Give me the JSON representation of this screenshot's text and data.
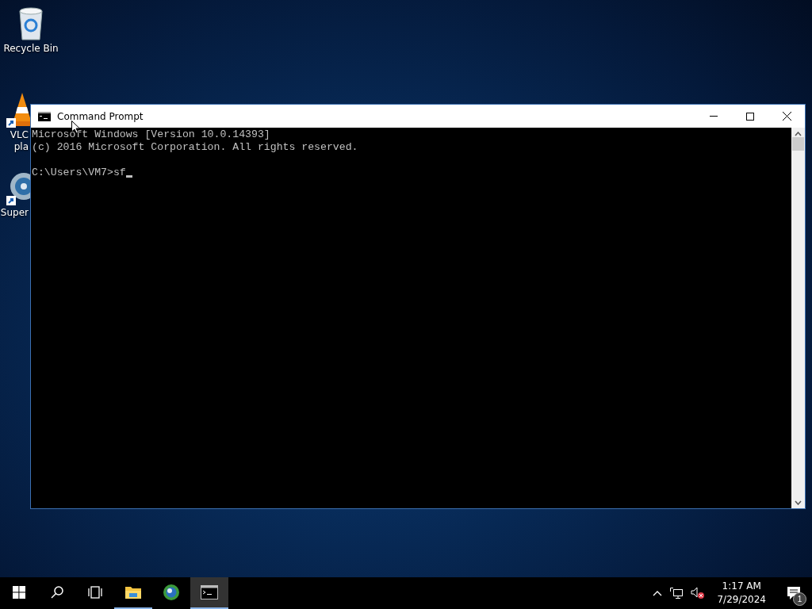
{
  "desktop_icons": [
    {
      "kind": "recycle",
      "lines": [
        "Recycle Bin"
      ],
      "shortcut": false,
      "partly_hidden": false
    },
    {
      "kind": "cone",
      "lines": [
        "VLC",
        "pla"
      ],
      "shortcut": true,
      "partly_hidden": true
    },
    {
      "kind": "disc",
      "lines": [
        "Super"
      ],
      "shortcut": true,
      "partly_hidden": true
    }
  ],
  "window": {
    "title": "Command Prompt",
    "console_lines": [
      "Microsoft Windows [Version 10.0.14393]",
      "(c) 2016 Microsoft Corporation. All rights reserved."
    ],
    "prompt": "C:\\Users\\VM7>sf"
  },
  "taskbar": {
    "apps": [
      {
        "kind": "start",
        "running": false,
        "selected": false
      },
      {
        "kind": "search",
        "running": false,
        "selected": false
      },
      {
        "kind": "taskview",
        "running": false,
        "selected": false
      },
      {
        "kind": "folder",
        "running": true,
        "selected": false
      },
      {
        "kind": "browser",
        "running": false,
        "selected": false
      },
      {
        "kind": "console",
        "running": true,
        "selected": true
      }
    ],
    "time": "1:17 AM",
    "date": "7/29/2024",
    "notification_count": "1"
  }
}
